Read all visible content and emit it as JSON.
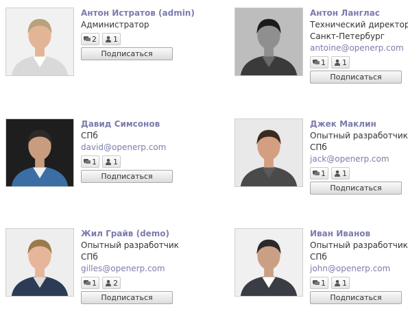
{
  "people": [
    {
      "name": "Антон Истратов (admin)",
      "lines": [
        "Администратор"
      ],
      "email": "",
      "messages": "2",
      "followers": "1",
      "button": "Подписаться",
      "avatar": "avatar-photo"
    },
    {
      "name": "Антон Ланглас",
      "lines": [
        "Технический директор",
        "Санкт-Петербург"
      ],
      "email": "antoine@openerp.com",
      "messages": "1",
      "followers": "1",
      "button": "Подписаться",
      "avatar": "avatar-photo"
    },
    {
      "name": "Давид Симсонов",
      "lines": [
        "СПб"
      ],
      "email": "david@openerp.com",
      "messages": "1",
      "followers": "1",
      "button": "Подписаться",
      "avatar": "avatar-photo"
    },
    {
      "name": "Джек Маклин",
      "lines": [
        "Опытный разработчик",
        "СПб"
      ],
      "email": "jack@openerp.com",
      "messages": "1",
      "followers": "1",
      "button": "Подписаться",
      "avatar": "avatar-photo"
    },
    {
      "name": "Жил Грайв (demo)",
      "lines": [
        "Опытный разработчик",
        "СПб"
      ],
      "email": "gilles@openerp.com",
      "messages": "1",
      "followers": "2",
      "button": "Подписаться",
      "avatar": "avatar-photo"
    },
    {
      "name": "Иван Иванов",
      "lines": [
        "Опытный разработчик",
        "СПб"
      ],
      "email": "john@openerp.com",
      "messages": "1",
      "followers": "1",
      "button": "Подписаться",
      "avatar": "avatar-photo"
    }
  ],
  "icons": {
    "message": "messages-icon",
    "follower": "follower-icon"
  },
  "colors": {
    "name": "#7c7bad",
    "email": "#7c7bad"
  }
}
